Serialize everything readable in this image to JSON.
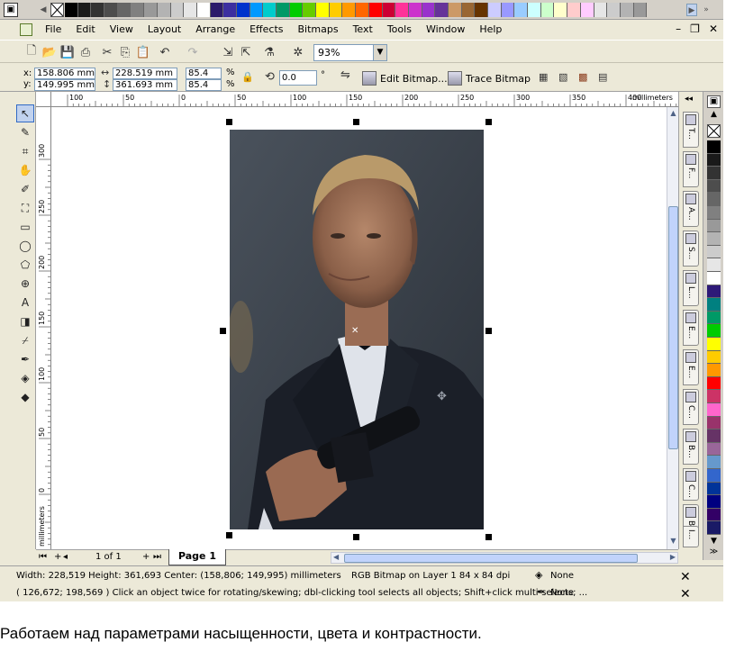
{
  "menu": {
    "items": [
      "File",
      "Edit",
      "View",
      "Layout",
      "Arrange",
      "Effects",
      "Bitmaps",
      "Text",
      "Tools",
      "Window",
      "Help"
    ]
  },
  "top_palette": {
    "colors": [
      "#000000",
      "#1a1a1a",
      "#333333",
      "#4d4d4d",
      "#666666",
      "#808080",
      "#999999",
      "#b3b3b3",
      "#cccccc",
      "#e6e6e6",
      "#ffffff",
      "#2b1a6b",
      "#3c2fa0",
      "#0033cc",
      "#0099ff",
      "#00cccc",
      "#009966",
      "#00cc00",
      "#66cc00",
      "#ffff00",
      "#ffcc00",
      "#ff9900",
      "#ff6600",
      "#ff0000",
      "#cc0033",
      "#ff3399",
      "#cc33cc",
      "#9933cc",
      "#663399",
      "#cc9966",
      "#996633",
      "#663300",
      "#ccccff",
      "#9999ff",
      "#99ccff",
      "#ccffff",
      "#ccffcc",
      "#ffffcc",
      "#ffcccc",
      "#ffccff",
      "#e6e6e6",
      "#cccccc",
      "#b3b3b3",
      "#999999"
    ]
  },
  "toolbar": {
    "zoom": "93%"
  },
  "propbar": {
    "x_label": "x:",
    "y_label": "y:",
    "x": "158.806 mm",
    "y": "149.995 mm",
    "width": "228.519 mm",
    "height": "361.693 mm",
    "scale_w": "85.4",
    "scale_h": "85.4",
    "percent": "%",
    "rotation": "0.0",
    "degree": "°",
    "edit_bitmap": "Edit Bitmap...",
    "trace_bitmap": "Trace Bitmap"
  },
  "hruler": {
    "labels": [
      "100",
      "50",
      "0",
      "50",
      "100",
      "150",
      "200",
      "250",
      "300",
      "350",
      "400"
    ],
    "unit": "millimeters"
  },
  "vruler": {
    "labels": [
      "300",
      "250",
      "200",
      "150",
      "100",
      "50",
      "0"
    ],
    "unit": "millimeters"
  },
  "dockers": {
    "tabs": [
      "T...",
      "F...",
      "A...",
      "S...",
      "L...",
      "E...",
      "E...",
      "C...",
      "B...",
      "C...",
      "B...",
      "I..."
    ]
  },
  "right_palette": {
    "colors": [
      "#000000",
      "#1a1a1a",
      "#333333",
      "#4d4d4d",
      "#666666",
      "#808080",
      "#999999",
      "#b3b3b3",
      "#cccccc",
      "#e6e6e6",
      "#ffffff",
      "#2e1a78",
      "#008080",
      "#009966",
      "#00cc00",
      "#ffff00",
      "#ffcc00",
      "#ff9900",
      "#ff0000",
      "#cc3366",
      "#ff66cc",
      "#99336b",
      "#663366",
      "#996699",
      "#6699cc",
      "#3366cc",
      "#003399",
      "#000080",
      "#330066",
      "#1a1a66"
    ]
  },
  "pagebar": {
    "page_of": "1 of 1",
    "page_tab": "Page 1"
  },
  "status": {
    "line1": "Width: 228,519  Height: 361,693  Center: (158,806; 149,995)  millimeters",
    "object_info": "RGB Bitmap on Layer 1 84 x 84 dpi",
    "fill": "None",
    "line2": "( 126,672; 198,569 )    Click an object twice for rotating/skewing; dbl-clicking tool selects all objects; Shift+click multi-selects; ...",
    "outline": "None"
  },
  "caption": "Работаем над параметрами насыщенности, цвета и контрастности."
}
